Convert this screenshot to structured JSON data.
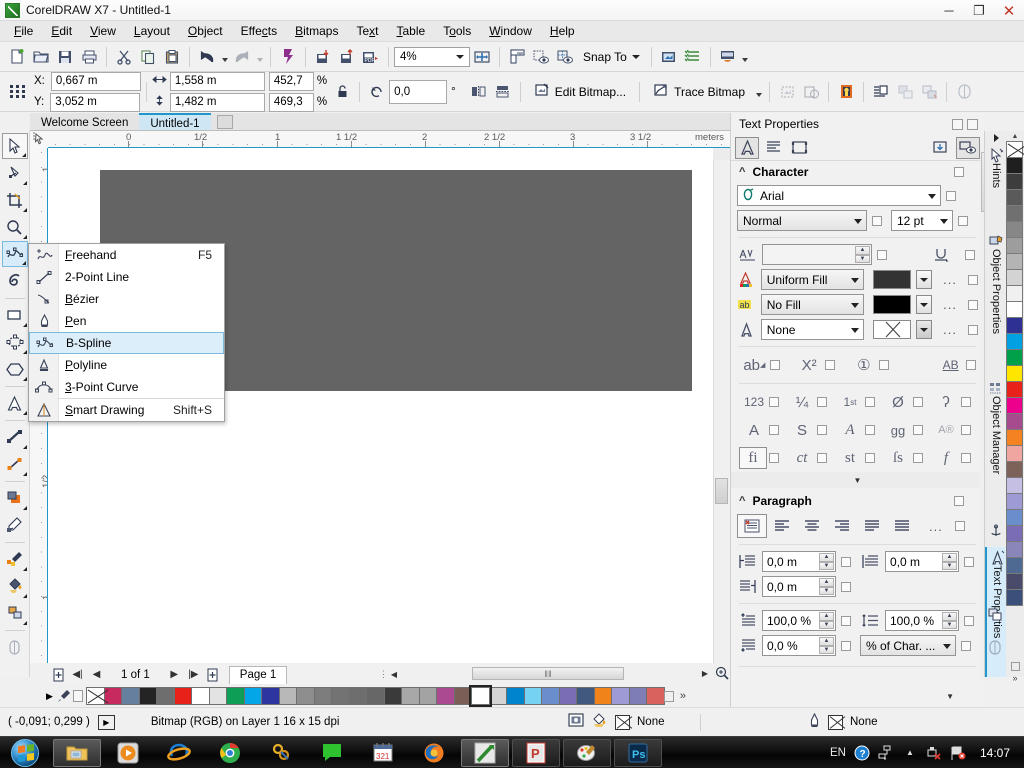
{
  "window": {
    "title": "CorelDRAW X7 - Untitled-1",
    "logo_icon": "coreldraw-logo-icon",
    "minimize_label": "─",
    "maximize_label": "❐",
    "close_label": "✕"
  },
  "menubar": [
    {
      "label": "File",
      "accel": "F"
    },
    {
      "label": "Edit",
      "accel": "E"
    },
    {
      "label": "View",
      "accel": "V"
    },
    {
      "label": "Layout",
      "accel": "L"
    },
    {
      "label": "Object",
      "accel": "O"
    },
    {
      "label": "Effects",
      "accel": "c"
    },
    {
      "label": "Bitmaps",
      "accel": "B"
    },
    {
      "label": "Text",
      "accel": "x"
    },
    {
      "label": "Table",
      "accel": "T"
    },
    {
      "label": "Tools",
      "accel": "o"
    },
    {
      "label": "Window",
      "accel": "W"
    },
    {
      "label": "Help",
      "accel": "H"
    }
  ],
  "standard_toolbar": {
    "items": [
      {
        "name": "new-document-button",
        "icon": "new-document-icon"
      },
      {
        "name": "open-button",
        "icon": "open-folder-icon"
      },
      {
        "name": "save-button",
        "icon": "save-disk-icon"
      },
      {
        "name": "print-button",
        "icon": "printer-icon"
      },
      {
        "name": "cut-button",
        "icon": "scissors-icon"
      },
      {
        "name": "copy-button",
        "icon": "copy-icon"
      },
      {
        "name": "paste-button",
        "icon": "paste-icon"
      },
      {
        "name": "undo-button",
        "icon": "undo-arrow-icon"
      },
      {
        "name": "redo-button",
        "icon": "redo-arrow-icon"
      },
      {
        "name": "corel-connect-button",
        "icon": "corel-connect-icon"
      },
      {
        "name": "import-button",
        "icon": "import-icon"
      },
      {
        "name": "export-button",
        "icon": "export-icon"
      },
      {
        "name": "export-pdf-button",
        "icon": "export-pdf-icon"
      }
    ],
    "zoom_level": "4%",
    "fullscreen_icon": "full-screen-preview-icon",
    "show_rulers_icon": "ruler-icon",
    "show_grid_icon": "grid-eye-icon",
    "show_guides_icon": "guides-eye-icon",
    "snap_to_label": "Snap To",
    "options_icon": "options-icon",
    "object_styles_icon": "object-styles-icon",
    "launch_icon": "application-launcher-icon"
  },
  "property_bar": {
    "object_icon": "object-position-icon",
    "x_label": "X:",
    "x_value": "0,667 m",
    "y_label": "Y:",
    "y_value": "3,052 m",
    "width_icon": "width-icon",
    "width_value": "1,558 m",
    "height_icon": "height-icon",
    "height_value": "1,482 m",
    "scale_x": "452,7",
    "scale_y": "469,3",
    "percent_symbol": "%",
    "lock_icon": "lock-ratio-icon",
    "rotate_icon": "rotate-icon",
    "rotation_value": "0,0",
    "degree_symbol": "°",
    "mirror_h_icon": "mirror-horizontal-icon",
    "mirror_v_icon": "mirror-vertical-icon",
    "edit_bitmap_label": "Edit Bitmap...",
    "edit_bitmap_icon": "edit-bitmap-icon",
    "trace_bitmap_label": "Trace Bitmap",
    "trace_bitmap_icon": "trace-bitmap-icon",
    "resample_icon": "resample-icon",
    "bitmap_color_mask_icon": "bitmap-color-mask-icon",
    "adjust_icon": "image-adjustment-icon",
    "wrap_text_icon": "wrap-paragraph-text-icon",
    "front_icon": "to-front-icon",
    "back_icon": "to-back-icon",
    "transparency_icon": "transparency-icon"
  },
  "document_tabs": {
    "tabs": [
      {
        "label": "Welcome Screen",
        "active": false
      },
      {
        "label": "Untitled-1",
        "active": true
      }
    ]
  },
  "toolbox": [
    {
      "name": "pick-tool",
      "icon": "arrow-cursor-icon",
      "selected": false,
      "boxed": true
    },
    {
      "name": "shape-tool",
      "icon": "shape-node-icon",
      "selected": false
    },
    {
      "name": "crop-tool",
      "icon": "crop-icon",
      "selected": false
    },
    {
      "name": "zoom-tool",
      "icon": "magnifier-icon",
      "selected": false
    },
    {
      "name": "freehand-tool",
      "icon": "b-spline-icon",
      "selected": true
    },
    {
      "name": "artistic-media-tool",
      "icon": "artistic-media-icon",
      "selected": false
    },
    {
      "name": "rectangle-tool",
      "icon": "rectangle-icon",
      "selected": false
    },
    {
      "name": "ellipse-tool",
      "icon": "ellipse-icon",
      "selected": false
    },
    {
      "name": "polygon-tool",
      "icon": "polygon-icon",
      "selected": false
    },
    {
      "name": "text-tool",
      "icon": "text-a-icon",
      "selected": false
    },
    {
      "name": "parallel-dimension-tool",
      "icon": "dimension-icon",
      "selected": false
    },
    {
      "name": "connector-tool",
      "icon": "connector-icon",
      "selected": false
    },
    {
      "name": "drop-shadow-tool",
      "icon": "drop-shadow-icon",
      "selected": false
    },
    {
      "name": "transparency-tool",
      "icon": "transparency-tool-icon",
      "selected": false
    },
    {
      "name": "color-eyedropper-tool",
      "icon": "eyedropper-icon",
      "selected": false
    },
    {
      "name": "interactive-fill-tool",
      "icon": "fill-bucket-icon",
      "selected": false
    },
    {
      "name": "smart-fill-tool",
      "icon": "smart-fill-icon",
      "selected": false
    },
    {
      "name": "outline-tool",
      "icon": "outline-pen-icon",
      "selected": false
    }
  ],
  "flyout_menu": {
    "name": "curve-tools-flyout",
    "items": [
      {
        "label": "Freehand",
        "accel": "F",
        "shortcut": "F5",
        "icon": "freehand-icon",
        "highlighted": false
      },
      {
        "label": "2-Point Line",
        "accel": "2",
        "shortcut": "",
        "icon": "two-point-line-icon",
        "highlighted": false
      },
      {
        "label": "Bézier",
        "accel": "B",
        "shortcut": "",
        "icon": "bezier-icon",
        "highlighted": false
      },
      {
        "label": "Pen",
        "accel": "P",
        "shortcut": "",
        "icon": "pen-icon",
        "highlighted": false
      },
      {
        "label": "B-Spline",
        "accel": "B",
        "shortcut": "",
        "icon": "b-spline-icon",
        "highlighted": true
      },
      {
        "label": "Polyline",
        "accel": "P",
        "shortcut": "",
        "icon": "polyline-icon",
        "highlighted": false
      },
      {
        "label": "3-Point Curve",
        "accel": "3",
        "shortcut": "",
        "icon": "three-point-curve-icon",
        "highlighted": false
      },
      {
        "label": "Smart Drawing",
        "accel": "S",
        "shortcut": "Shift+S",
        "icon": "smart-drawing-icon",
        "highlighted": false
      }
    ]
  },
  "rulers": {
    "unit_label": "meters",
    "h_labels": [
      "0",
      "1/2",
      "1",
      "1 1/2",
      "2",
      "2 1/2",
      "3",
      "3 1/2"
    ],
    "v_labels": [
      "1",
      "1/2",
      "0",
      "1/2",
      "1"
    ],
    "corner_icon": "ruler-origin-icon"
  },
  "canvas": {
    "object_name": "selected-bitmap-rectangle",
    "object_color": "#646464"
  },
  "page_navigator": {
    "add_page_before_icon": "add-page-before-icon",
    "first_page_icon": "◀|",
    "prev_page_icon": "◀",
    "page_count_label": "1 of 1",
    "next_page_icon": "▶",
    "last_page_icon": "|▶",
    "add_page_after_icon": "add-page-after-icon",
    "page_tab_label": "Page 1"
  },
  "scrollbars": {
    "h_thumb_grip": "‖‖",
    "zoom_to_fit_icon": "zoom-to-page-icon"
  },
  "palette": {
    "scroll_up_icon": "▶",
    "eyedropper_icon": "palette-eyedropper-icon",
    "swatches": [
      "none",
      "#c62a5e",
      "#667f9e",
      "#242424",
      "#6e6e6e",
      "#e8211b",
      "#ffffff",
      "#e3e3e3",
      "#0f9e56",
      "#03a7e8",
      "#2c35a0",
      "#b8b8b8",
      "#8e8e8e",
      "#7d7d7d",
      "#737373",
      "#6e6e6e",
      "#676767",
      "#3a3a3a",
      "#a8a8a8",
      "#a3a3a3",
      "#ab4a90",
      "#7b5e55",
      "#ffffff",
      "#d4d4d4",
      "#0084cc",
      "#76d2f2",
      "#6a8ecb",
      "#7a6cb5",
      "#41597f",
      "#f08319",
      "#9e9ad6",
      "#7e7db5",
      "#d9615e"
    ],
    "selected_swatch_index": 22,
    "more_icon": "»"
  },
  "status_bar": {
    "coordinates": "( -0,091; 0,299 )",
    "expand_icon": "▶",
    "object_info": "Bitmap (RGB) on Layer 1 16 x 15 dpi",
    "fill_icon": "fill-bucket-status-icon",
    "screen_icon": "color-proof-icon",
    "fill_value": "None",
    "outline_icon": "outline-pen-status-icon",
    "outline_value": "None"
  },
  "docker": {
    "title": "Text Properties",
    "tabs": [
      {
        "name": "character-tab",
        "icon": "character-a-icon",
        "selected": true
      },
      {
        "name": "paragraph-tab",
        "icon": "paragraph-lines-icon",
        "selected": false
      },
      {
        "name": "frame-tab",
        "icon": "text-frame-icon",
        "selected": false
      }
    ],
    "pin_icon": "pin-down-icon",
    "preview_icon": "preview-eye-icon",
    "character": {
      "section_label": "Character",
      "font_icon": "opentype-font-icon",
      "font_family": "Arial",
      "font_style": "Normal",
      "font_size": "12 pt",
      "kerning_icon": "kerning-icon",
      "kerning_value": "",
      "underline_icon": "underline-icon",
      "fill_type_icon": "text-fill-icon",
      "fill_type": "Uniform Fill",
      "fill_color": "#333333",
      "background_icon": "text-background-icon",
      "background_type": "No Fill",
      "background_color": "#000000",
      "outline_icon": "text-outline-icon",
      "outline_type": "None",
      "outline_color": "none",
      "more_label": "..."
    },
    "opentype": {
      "row1": [
        {
          "glyph": "ab",
          "name": "uppercase-icon",
          "boxed": false
        },
        {
          "glyph": "X²",
          "name": "position-icon",
          "boxed": false
        },
        {
          "glyph": "①",
          "name": "ornaments-icon",
          "boxed": false
        },
        {
          "glyph": "AB",
          "name": "underline-opentype-icon",
          "boxed": false
        }
      ],
      "row2": [
        {
          "glyph": "123",
          "name": "figure-style-icon",
          "boxed": false
        },
        {
          "glyph": "¼",
          "name": "fractions-icon",
          "boxed": false
        },
        {
          "glyph": "1st",
          "name": "ordinals-icon",
          "boxed": false
        },
        {
          "glyph": "Ø",
          "name": "slashed-zero-icon",
          "boxed": false
        },
        {
          "glyph": "ʃ",
          "name": "swash-icon",
          "boxed": false
        }
      ],
      "row3": [
        {
          "glyph": "A",
          "name": "titling-icon",
          "boxed": false
        },
        {
          "glyph": "S",
          "name": "stylistic-sets-icon",
          "boxed": false
        },
        {
          "glyph": "𝒜",
          "name": "italic-alternates-icon",
          "boxed": false
        },
        {
          "glyph": "gg",
          "name": "contextual-alternates-icon",
          "boxed": false
        },
        {
          "glyph": "A®",
          "name": "alternate-annotation-icon",
          "boxed": false
        }
      ],
      "row4": [
        {
          "glyph": "fi",
          "name": "standard-ligatures-icon",
          "boxed": true
        },
        {
          "glyph": "ct",
          "name": "discretionary-ligatures-icon",
          "boxed": false
        },
        {
          "glyph": "st",
          "name": "historical-ligatures-icon",
          "boxed": false
        },
        {
          "glyph": "ſs",
          "name": "contextual-ligatures-icon",
          "boxed": false
        },
        {
          "glyph": "f",
          "name": "ornament-f-icon",
          "boxed": false
        }
      ],
      "expand_icon": "▼"
    },
    "paragraph": {
      "section_label": "Paragraph",
      "align_buttons": [
        {
          "name": "align-none-button",
          "icon": "align-none-icon",
          "selected": true
        },
        {
          "name": "align-left-button",
          "icon": "align-left-icon",
          "selected": false
        },
        {
          "name": "align-center-button",
          "icon": "align-center-icon",
          "selected": false
        },
        {
          "name": "align-right-button",
          "icon": "align-right-icon",
          "selected": false
        },
        {
          "name": "align-full-justify-button",
          "icon": "align-full-justify-icon",
          "selected": false
        },
        {
          "name": "align-force-justify-button",
          "icon": "align-force-justify-icon",
          "selected": false
        }
      ],
      "align_more": "...",
      "left_indent_icon": "left-indent-icon",
      "left_indent": "0,0 m",
      "first_line_indent_icon": "first-line-indent-icon",
      "first_line_indent": "0,0 m",
      "right_indent_icon": "right-indent-icon",
      "right_indent": "0,0 m",
      "before_paragraph_icon": "space-before-icon",
      "before_paragraph": "100,0 %",
      "line_spacing_icon": "line-spacing-icon",
      "line_spacing": "100,0 %",
      "after_paragraph_icon": "space-after-icon",
      "after_paragraph": "0,0 %",
      "spacing_units": "% of Char. ..."
    }
  },
  "vertical_tabs": [
    {
      "label": "Hints",
      "icon": "hints-cursor-icon",
      "selected": false
    },
    {
      "label": "Object Properties",
      "icon": "object-properties-icon",
      "selected": false
    },
    {
      "label": "Object Manager",
      "icon": "object-manager-icon",
      "selected": false
    },
    {
      "label": "",
      "icon": "anchor-icon",
      "selected": false
    },
    {
      "label": "Text Properties",
      "icon": "text-properties-icon",
      "selected": true
    },
    {
      "label": "",
      "icon": "layers-icon",
      "selected": false
    },
    {
      "label": "",
      "icon": "transparency-docker-icon",
      "selected": false
    }
  ],
  "right_palette": {
    "swatches": [
      "none",
      "#1f1f1f",
      "#3d3d3d",
      "#5a5a5a",
      "#707070",
      "#878787",
      "#9d9d9d",
      "#b4b4b4",
      "#d3d3d3",
      "#f0f0f0",
      "#ffffff",
      "#2f3192",
      "#00a0e3",
      "#00a04b",
      "#ffe600",
      "#e8211b",
      "#ec008c",
      "#a64b8e",
      "#f58220",
      "#f0a6a0",
      "#7d6259",
      "#c4bfe3",
      "#9e9ad6",
      "#6a8ecb",
      "#7a6cb5",
      "#8a86ba",
      "#4e6a92",
      "#4a4a6b",
      "#3a4f7a"
    ],
    "dropdown_icon": "»"
  },
  "taskbar": {
    "start_icon": "windows-start-orb-icon",
    "items": [
      {
        "name": "windows-explorer-task",
        "icon": "folder-icon",
        "state": "open"
      },
      {
        "name": "media-player-task",
        "icon": "media-player-icon",
        "state": "pinned"
      },
      {
        "name": "internet-explorer-task",
        "icon": "internet-explorer-icon",
        "state": "pinned"
      },
      {
        "name": "chrome-task",
        "icon": "chrome-icon",
        "state": "pinned"
      },
      {
        "name": "utility-task",
        "icon": "gold-tools-icon",
        "state": "pinned"
      },
      {
        "name": "messenger-task",
        "icon": "green-chat-icon",
        "state": "pinned"
      },
      {
        "name": "calendar-task",
        "icon": "calendar-321-icon",
        "state": "pinned"
      },
      {
        "name": "firefox-task",
        "icon": "firefox-icon",
        "state": "pinned"
      },
      {
        "name": "coreldraw-task",
        "icon": "coreldraw-logo-icon",
        "state": "open"
      },
      {
        "name": "powerpoint-task",
        "icon": "powerpoint-icon",
        "state": "run"
      },
      {
        "name": "paint-task",
        "icon": "paint-palette-icon",
        "state": "run"
      },
      {
        "name": "photoshop-task",
        "icon": "photoshop-ps-icon",
        "state": "run"
      }
    ],
    "tray": {
      "language": "EN",
      "help_icon": "blue-question-help-icon",
      "network_icon": "network-icon",
      "show_hidden_icon": "▲",
      "safely_remove_icon": "safely-remove-hardware-icon",
      "flag_icon": "action-center-flag-icon",
      "clock": "14:07"
    }
  }
}
